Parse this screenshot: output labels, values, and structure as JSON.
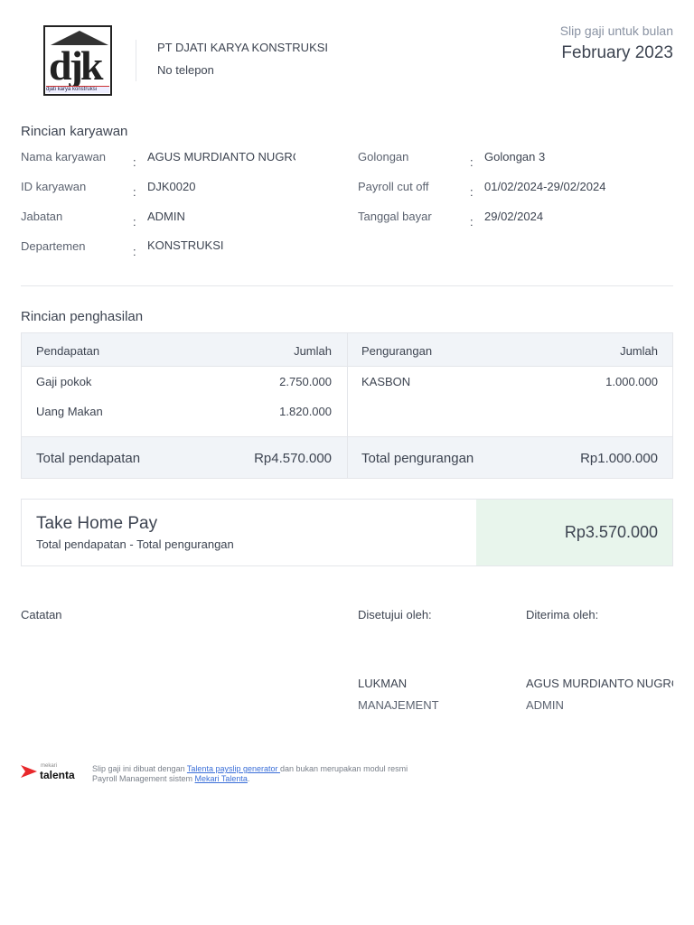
{
  "company": {
    "logo_text": "djk",
    "logo_sub": "djati karya konstruksi",
    "name": "PT DJATI KARYA KONSTRUKSI",
    "phone": "No telepon"
  },
  "slip": {
    "label": "Slip gaji untuk bulan",
    "month": "February 2023"
  },
  "employee": {
    "title": "Rincian karyawan",
    "name_label": "Nama karyawan",
    "name": "AGUS MURDIANTO NUGROHO",
    "id_label": "ID karyawan",
    "id": "DJK0020",
    "position_label": "Jabatan",
    "position": "ADMIN",
    "dept_label": "Departemen",
    "dept": "KONSTRUKSI",
    "grade_label": "Golongan",
    "grade": "Golongan 3",
    "cutoff_label": "Payroll cut off",
    "cutoff": "01/02/2024-29/02/2024",
    "paydate_label": "Tanggal bayar",
    "paydate": "29/02/2024",
    "colon": ":"
  },
  "income": {
    "title": "Rincian penghasilan",
    "earn_header": "Pendapatan",
    "amount_header": "Jumlah",
    "ded_header": "Pengurangan",
    "earnings": [
      {
        "label": "Gaji pokok",
        "value": "2.750.000"
      },
      {
        "label": "Uang Makan",
        "value": "1.820.000"
      }
    ],
    "deductions": [
      {
        "label": "KASBON",
        "value": "1.000.000"
      }
    ],
    "total_earn_label": "Total pendapatan",
    "total_earn": "Rp4.570.000",
    "total_ded_label": "Total pengurangan",
    "total_ded": "Rp1.000.000"
  },
  "thp": {
    "title": "Take Home Pay",
    "subtitle": "Total pendapatan - Total pengurangan",
    "value": "Rp3.570.000"
  },
  "sign": {
    "notes": "Catatan",
    "approved": "Disetujui oleh:",
    "received": "Diterima oleh:",
    "approver_name": "LUKMAN",
    "approver_role": "MANAJEMENT",
    "receiver_name": "AGUS MURDIANTO NUGROHO",
    "receiver_role": "ADMIN"
  },
  "footer": {
    "brand_small": "mekari",
    "brand": "talenta",
    "t1": "Slip gaji ini dibuat dengan ",
    "link1": "Talenta payslip generator ",
    "t2": "dan bukan merupakan modul resmi Payroll Management sistem ",
    "link2": "Mekari Talenta",
    "t3": "."
  }
}
